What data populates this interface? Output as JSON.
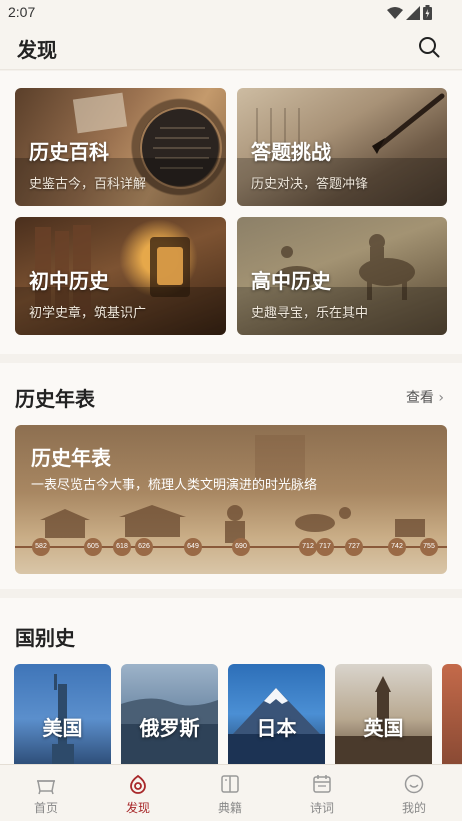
{
  "status_bar": {
    "time": "2:07"
  },
  "header": {
    "title": "发现"
  },
  "feature_cards": [
    {
      "title": "历史百科",
      "subtitle": "史鉴古今，百科详解"
    },
    {
      "title": "答题挑战",
      "subtitle": "历史对决，答题冲锋"
    },
    {
      "title": "初中历史",
      "subtitle": "初学史章，筑基识广"
    },
    {
      "title": "高中历史",
      "subtitle": "史趣寻宝，乐在其中"
    }
  ],
  "timeline_section": {
    "title": "历史年表",
    "view_label": "查看",
    "banner": {
      "title": "历史年表",
      "subtitle": "一表尽览古今大事，梳理人类文明演进的时光脉络",
      "years": [
        "582",
        "605",
        "618",
        "626",
        "649",
        "690",
        "712",
        "717",
        "727",
        "742",
        "755"
      ]
    }
  },
  "country_section": {
    "title": "国别史",
    "countries": [
      "美国",
      "俄罗斯",
      "日本",
      "英国"
    ]
  },
  "tabbar": {
    "active": "发现",
    "tabs": [
      {
        "label": "首页",
        "icon": "home-icon"
      },
      {
        "label": "发现",
        "icon": "discover-icon"
      },
      {
        "label": "典籍",
        "icon": "book-icon"
      },
      {
        "label": "诗词",
        "icon": "poetry-icon"
      },
      {
        "label": "我的",
        "icon": "profile-icon"
      }
    ]
  },
  "colors": {
    "accent": "#a8282a",
    "background": "#f4f1ec"
  }
}
